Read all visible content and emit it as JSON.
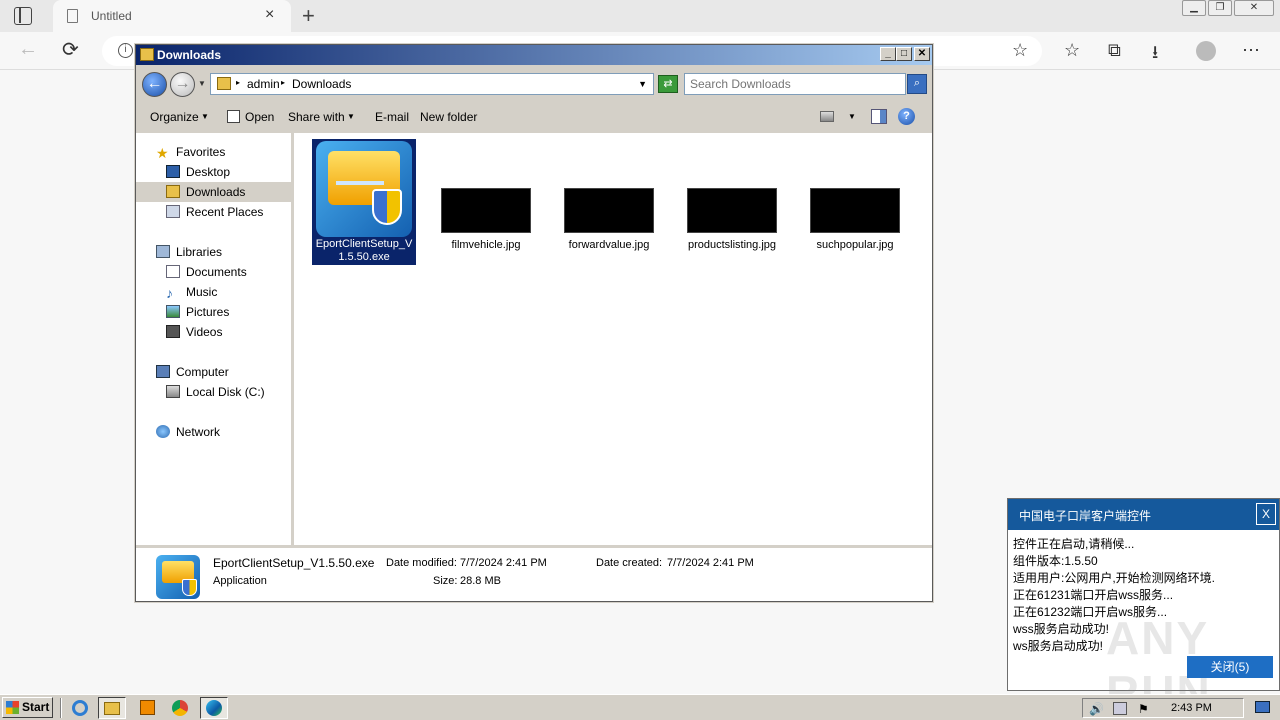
{
  "browser": {
    "tab_title": "Untitled",
    "tab_close": "×",
    "new_tab": "+",
    "addr_info": "i"
  },
  "explorer": {
    "title": "Downloads",
    "breadcrumb": [
      "admin",
      "Downloads"
    ],
    "search_placeholder": "Search Downloads",
    "toolbar": {
      "organize": "Organize",
      "open": "Open",
      "share_with": "Share with",
      "email": "E-mail",
      "new_folder": "New folder"
    },
    "nav": {
      "favorites": "Favorites",
      "desktop": "Desktop",
      "downloads": "Downloads",
      "recent_places": "Recent Places",
      "libraries": "Libraries",
      "documents": "Documents",
      "music": "Music",
      "pictures": "Pictures",
      "videos": "Videos",
      "computer": "Computer",
      "local_disk": "Local Disk (C:)",
      "network": "Network"
    },
    "files": [
      {
        "name_line1": "EportClientSetup_V",
        "name_line2": "1.5.50.exe",
        "type": "exe",
        "selected": true
      },
      {
        "name": "filmvehicle.jpg",
        "type": "jpg"
      },
      {
        "name": "forwardvalue.jpg",
        "type": "jpg"
      },
      {
        "name": "productslisting.jpg",
        "type": "jpg"
      },
      {
        "name": "suchpopular.jpg",
        "type": "jpg"
      }
    ],
    "details": {
      "name": "EportClientSetup_V1.5.50.exe",
      "type": "Application",
      "date_modified_label": "Date modified:",
      "date_modified": "7/7/2024 2:41 PM",
      "size_label": "Size:",
      "size": "28.8 MB",
      "date_created_label": "Date created:",
      "date_created": "7/7/2024 2:41 PM"
    }
  },
  "popup": {
    "title": "中国电子口岸客户端控件",
    "close": "X",
    "lines": [
      "控件正在启动,请稍候...",
      "组件版本:1.5.50",
      "适用用户:公网用户,开始检测网络环境.",
      "正在61231端口开启wss服务...",
      "正在61232端口开启ws服务...",
      "wss服务启动成功!",
      "ws服务启动成功!"
    ],
    "button": "关闭(5)",
    "watermark": "ANY RUN"
  },
  "taskbar": {
    "start": "Start",
    "clock": "2:43 PM"
  },
  "colors": {
    "explorer_title": "#0a246a",
    "popup_title": "#15599c",
    "popup_button": "#1e6ec4",
    "selection": "#0a246a",
    "taskbar": "#d4d0c8"
  }
}
